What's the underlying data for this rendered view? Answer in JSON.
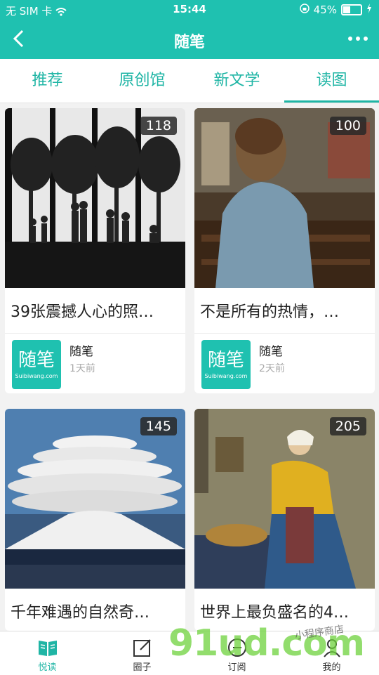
{
  "status": {
    "carrier": "无 SIM 卡",
    "time": "15:44",
    "battery": "45%",
    "battery_level": 0.45
  },
  "nav": {
    "title": "随笔"
  },
  "tabs": [
    {
      "label": "推荐",
      "active": false
    },
    {
      "label": "原创馆",
      "active": false
    },
    {
      "label": "新文学",
      "active": false
    },
    {
      "label": "读图",
      "active": true
    }
  ],
  "cards": [
    {
      "count": "118",
      "title": "39张震撼人心的照…",
      "source": "随笔",
      "time": "1天前",
      "logo_text": "随笔",
      "logo_sub": "Suibiwang.com"
    },
    {
      "count": "100",
      "title": "不是所有的热情，…",
      "source": "随笔",
      "time": "2天前",
      "logo_text": "随笔",
      "logo_sub": "Suibiwang.com"
    },
    {
      "count": "145",
      "title": "千年难遇的自然奇…"
    },
    {
      "count": "205",
      "title": "世界上最负盛名的4…"
    }
  ],
  "bottom_nav": [
    {
      "label": "悦读",
      "icon": "book-icon",
      "active": true
    },
    {
      "label": "圈子",
      "icon": "edit-icon",
      "active": false
    },
    {
      "label": "订阅",
      "icon": "subscribe-icon",
      "active": false
    },
    {
      "label": "我的",
      "icon": "user-icon",
      "active": false
    }
  ],
  "watermark": {
    "text": "91ud.com",
    "sub": "小程序商店"
  },
  "colors": {
    "accent": "#1fc1b0"
  }
}
